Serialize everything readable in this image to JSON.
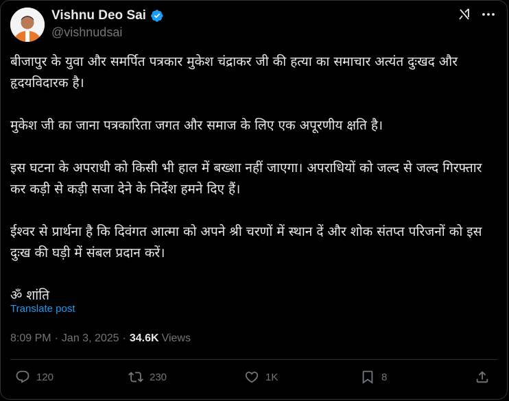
{
  "author": {
    "display_name": "Vishnu Deo Sai",
    "handle": "@vishnudsai",
    "verified": true
  },
  "header_icons": [
    "grok-icon",
    "more-icon"
  ],
  "post": {
    "paragraphs": [
      "बीजापुर के युवा और समर्पित पत्रकार मुकेश चंद्राकर जी की हत्या का समाचार अत्यंत दुःखद और हृदयविदारक है।",
      "मुकेश जी का जाना पत्रकारिता जगत और समाज के लिए एक अपूरणीय क्षति है।",
      "इस घटना के अपराधी को किसी भी हाल में बख्शा नहीं जाएगा। अपराधियों को जल्द से जल्द गिरफ्तार कर कड़ी से कड़ी सजा देने के निर्देश हमने दिए हैं।",
      "ईश्वर से प्रार्थना है कि दिवंगत आत्मा को अपने श्री चरणों में स्थान दें और शोक संतप्त परिजनों को इस दुःख की घड़ी में संबल प्रदान करें।",
      "ॐ शांति"
    ],
    "translate_label": "Translate post"
  },
  "meta": {
    "time": "8:09 PM",
    "separator": "·",
    "date": "Jan 3, 2025",
    "views_count": "34.6K",
    "views_label": "Views"
  },
  "actions": {
    "replies": "120",
    "reposts": "230",
    "likes": "1K",
    "bookmarks": "8"
  },
  "colors": {
    "background": "#000000",
    "text": "#e7e9ea",
    "secondary": "#71767b",
    "link": "#1d9bf0",
    "verified": "#1d9bf0",
    "border": "#2f3336"
  }
}
